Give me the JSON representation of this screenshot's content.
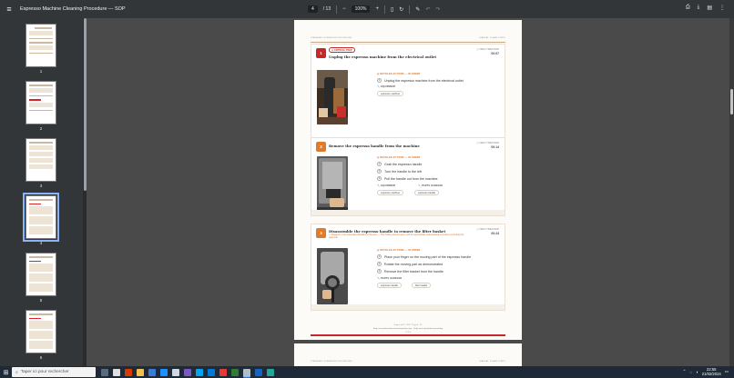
{
  "window": {
    "title": "Espresso Machine Cleaning Procedure — SOP"
  },
  "toolbar": {
    "page_current": "4",
    "page_total": "/ 13",
    "zoom": "100%",
    "zoom_out": "−",
    "zoom_in": "+"
  },
  "thumbnails": [
    {
      "label": "1"
    },
    {
      "label": "2"
    },
    {
      "label": "3"
    },
    {
      "label": "4"
    },
    {
      "label": "5"
    },
    {
      "label": "6"
    }
  ],
  "page": {
    "header_left": "STANDARD OPERATING PROCEDURE",
    "header_right": "MANUAL CLEAN STEPS",
    "footer_line1": "Page 4 of 13 · SOP · Page 4 · 13",
    "footer_line2": "Steps are performed by trained operators only · Verify each step before proceeding",
    "footer_line3": "4 / 13"
  },
  "labels": {
    "detailed_actions": "DETAILED ACTIONS — IN ORDER",
    "equipment": "EQUIPMENT",
    "parts_handled": "PARTS HANDLED",
    "video_timestamp": "VIDEO TIMESTAMP"
  },
  "steps": [
    {
      "number": "1",
      "critical": "CRITICAL STEP",
      "title": "Unplug the espresso machine from the electrical outlet",
      "timestamp": "00:07",
      "actions": [
        "Unplug the espresso machine from the electrical outlet"
      ],
      "equipment": [
        "espresso machine"
      ],
      "parts": []
    },
    {
      "number": "2",
      "title": "Remove the espresso handle from the machine",
      "timestamp": "00:14",
      "actions": [
        "Grab the espresso handle",
        "Turn the handle to the left",
        "Pull the handle out from the machine"
      ],
      "equipment": [
        "espresso machine"
      ],
      "parts": [
        "espresso handle"
      ]
    },
    {
      "number": "3",
      "title": "Disassemble the espresso handle to remove the filter basket",
      "warning": "Flagged in the Automated Readiness Review — This finding should open until the appropriate acknowledgment when recording this approval.",
      "timestamp": "00:24",
      "actions": [
        "Place your finger on the moving part of the espresso handle",
        "Rotate the moving part as demonstrated",
        "Remove the filter basket from the handle"
      ],
      "equipment": [],
      "parts": [
        "espresso handle",
        "filter basket"
      ]
    }
  ],
  "taskbar": {
    "search_placeholder": "Taper ici pour rechercher",
    "time": "22:55",
    "date": "21/02/2024"
  },
  "colors": {
    "accent_red": "#c62828",
    "accent_orange": "#e07b2b",
    "toolbar_bg": "#323639"
  }
}
